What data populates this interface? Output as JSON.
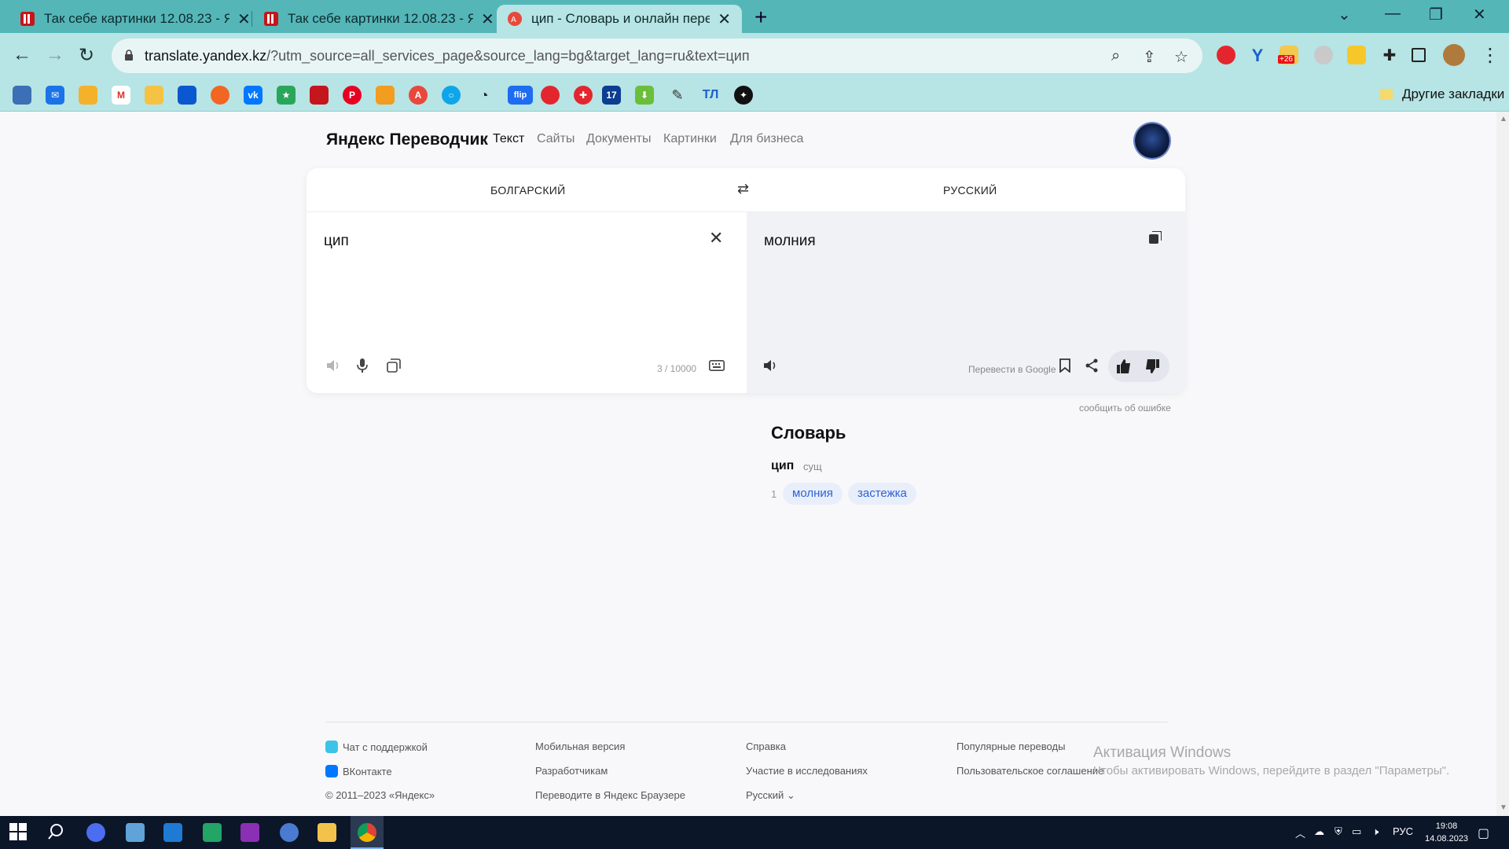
{
  "browser": {
    "tabs": [
      {
        "title": "Так себе картинки 12.08.23 - ЯП",
        "active": false
      },
      {
        "title": "Так себе картинки 12.08.23 - ЯП",
        "active": false
      },
      {
        "title": "цип - Словарь и онлайн перево",
        "active": true
      }
    ],
    "new_tab": "+",
    "url_host": "translate.yandex.kz",
    "url_path": "/?utm_source=all_services_page&source_lang=bg&target_lang=ru&text=цип",
    "weather_badge": "+26",
    "other_bookmarks": "Другие закладки",
    "bookmark_tl": "ТЛ"
  },
  "header": {
    "brand": "Яндекс Переводчик",
    "nav": [
      "Текст",
      "Сайты",
      "Документы",
      "Картинки",
      "Для бизнеса"
    ],
    "active_nav": "Текст"
  },
  "translator": {
    "source_lang": "БОЛГАРСКИЙ",
    "target_lang": "РУССКИЙ",
    "source_text": "цип",
    "target_text": "молния",
    "counter": "3 / 10000",
    "translate_google": "Перевести в Google",
    "report_error": "сообщить об ошибке"
  },
  "dictionary": {
    "title": "Словарь",
    "word": "цип",
    "pos": "сущ",
    "entries": [
      {
        "num": "1",
        "translations": [
          "молния",
          "застежка"
        ]
      }
    ]
  },
  "footer": {
    "col1": [
      "Чат с поддержкой",
      "ВКонтакте",
      "© 2011–2023 «Яндекс»"
    ],
    "col2": [
      "Мобильная версия",
      "Разработчикам",
      "Переводите в Яндекс Браузере"
    ],
    "col3": [
      "Справка",
      "Участие в исследованиях",
      "Русский"
    ],
    "col4": [
      "Популярные переводы",
      "Пользовательское соглашение"
    ]
  },
  "watermark": {
    "title": "Активация Windows",
    "subtitle": "Чтобы активировать Windows, перейдите в раздел \"Параметры\"."
  },
  "taskbar": {
    "lang": "РУС",
    "time": "19:08",
    "date": "14.08.2023"
  },
  "colors": {
    "chrome_accent": "#55b6b8",
    "toolbar": "#b7e4e4",
    "chip_text": "#2f61d5",
    "chip_bg": "#e9eefb"
  }
}
